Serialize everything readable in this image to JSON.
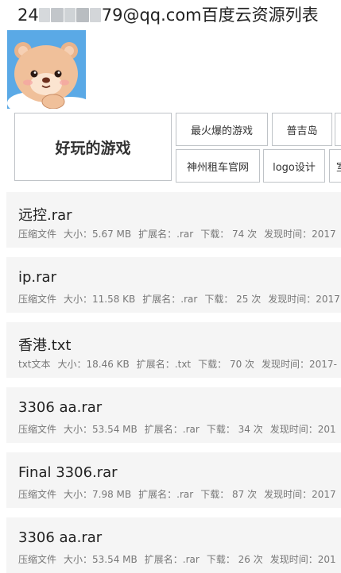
{
  "header": {
    "title_prefix_visible": "24",
    "title_tail": "79@qq.com百度云资源列表"
  },
  "tags": {
    "featured": "好玩的游戏",
    "items": [
      "最火爆的游戏",
      "普吉岛",
      "神州租车官网",
      "logo设计",
      "室"
    ]
  },
  "files": [
    {
      "name": "远控.rar",
      "type": "压缩文件",
      "size": "大小：5.67 MB",
      "ext": "扩展名：.rar",
      "downloads": "下载：  74 次",
      "found": "发现时间：2017"
    },
    {
      "name": "ip.rar",
      "type": "压缩文件",
      "size": "大小：11.58 KB",
      "ext": "扩展名：.rar",
      "downloads": "下载：  25 次",
      "found": "发现时间：2017"
    },
    {
      "name": "香港.txt",
      "type": "txt文本",
      "size": "大小：18.46 KB",
      "ext": "扩展名：.txt",
      "downloads": "下载：  70 次",
      "found": "发现时间：2017-"
    },
    {
      "name": "3306 aa.rar",
      "type": "压缩文件",
      "size": "大小：53.54 MB",
      "ext": "扩展名：.rar",
      "downloads": "下载：  34 次",
      "found": "发现时间：201"
    },
    {
      "name": "Final 3306.rar",
      "type": "压缩文件",
      "size": "大小：7.98 MB",
      "ext": "扩展名：.rar",
      "downloads": "下载：  87 次",
      "found": "发现时间：2017"
    },
    {
      "name": "3306 aa.rar",
      "type": "压缩文件",
      "size": "大小：53.54 MB",
      "ext": "扩展名：.rar",
      "downloads": "下载：  26 次",
      "found": "发现时间：201"
    }
  ],
  "colors": {
    "card_bg": "#f5f5f5",
    "tag_border": "#bfc3c7",
    "avatar_sky": "#5aa9e6"
  }
}
